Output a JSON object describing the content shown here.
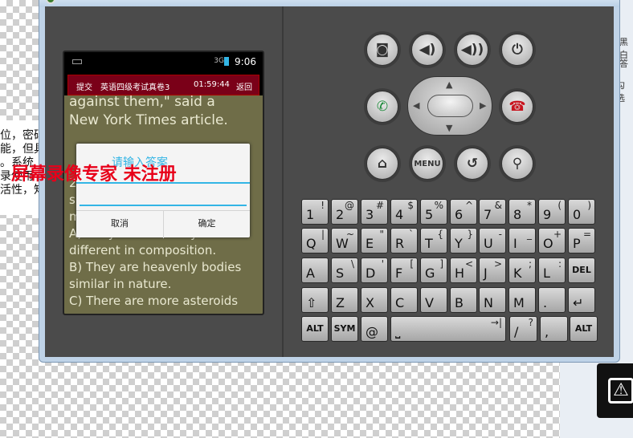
{
  "left_doc": {
    "lines": [
      "位，密码",
      "能，但具",
      "。系统",
      "录使用",
      "活性，知"
    ]
  },
  "right_panel": {
    "lines": [
      "黑白",
      "答",
      "勾选"
    ]
  },
  "device": {
    "status_time": "9:06",
    "status_signal": "3G",
    "app_bar": {
      "submit": "提交",
      "title": "英语四级考试真卷3",
      "timer": "01:59:44",
      "back": "返回"
    },
    "content_lines": [
      "against them,\" said a",
      "New York Times article.",
      "2",
      "s",
      "m",
      "A) They are heavenly bodies",
      "different in composition.",
      "B) They are heavenly bodies",
      "similar in nature.",
      "C) There are more asteroids"
    ]
  },
  "dialog": {
    "title": "请输入答案",
    "input_value": "",
    "cancel": "取消",
    "ok": "确定"
  },
  "watermark": "屏幕录像专家  未注册",
  "hw_buttons": {
    "camera": "camera-icon",
    "vol_down": "volume-down-icon",
    "vol_up": "volume-up-icon",
    "power": "power-icon",
    "call": "call-icon",
    "end_call": "end-call-icon",
    "home": "home-icon",
    "menu": "MENU",
    "back": "back-icon",
    "search": "search-icon"
  },
  "keyboard": {
    "row1": [
      [
        "1",
        "!"
      ],
      [
        "2",
        "@"
      ],
      [
        "3",
        "#"
      ],
      [
        "4",
        "$"
      ],
      [
        "5",
        "%"
      ],
      [
        "6",
        "^"
      ],
      [
        "7",
        "&"
      ],
      [
        "8",
        "*"
      ],
      [
        "9",
        "("
      ],
      [
        "0",
        ")"
      ]
    ],
    "row2": [
      [
        "Q",
        "|"
      ],
      [
        "W",
        "~"
      ],
      [
        "E",
        "\""
      ],
      [
        "R",
        "`"
      ],
      [
        "T",
        "{"
      ],
      [
        "Y",
        "}"
      ],
      [
        "U",
        "-"
      ],
      [
        "I",
        "_"
      ],
      [
        "O",
        "+"
      ],
      [
        "P",
        "="
      ]
    ],
    "row3": [
      [
        "A",
        ""
      ],
      [
        "S",
        "\\"
      ],
      [
        "D",
        "'"
      ],
      [
        "F",
        "["
      ],
      [
        "G",
        "]"
      ],
      [
        "H",
        "<"
      ],
      [
        "J",
        ">"
      ],
      [
        "K",
        ";"
      ],
      [
        "L",
        ":"
      ],
      [
        "DEL",
        ""
      ]
    ],
    "row4": [
      [
        "⇧",
        ""
      ],
      [
        "Z",
        ""
      ],
      [
        "X",
        ""
      ],
      [
        "C",
        ""
      ],
      [
        "V",
        ""
      ],
      [
        "B",
        ""
      ],
      [
        "N",
        ""
      ],
      [
        "M",
        ""
      ],
      [
        ".",
        ""
      ],
      [
        "↵",
        ""
      ]
    ],
    "row5": [
      [
        "ALT",
        ""
      ],
      [
        "SYM",
        ""
      ],
      [
        "@",
        ""
      ],
      [
        "⎵",
        "→|"
      ],
      [
        "/",
        "?"
      ],
      [
        ",",
        ""
      ],
      [
        "ALT",
        ""
      ]
    ]
  },
  "colors": {
    "app_bar": "#7a0018",
    "content_bg": "#6f6d48",
    "dialog_accent": "#33b5e5",
    "watermark": "#e8001a"
  }
}
